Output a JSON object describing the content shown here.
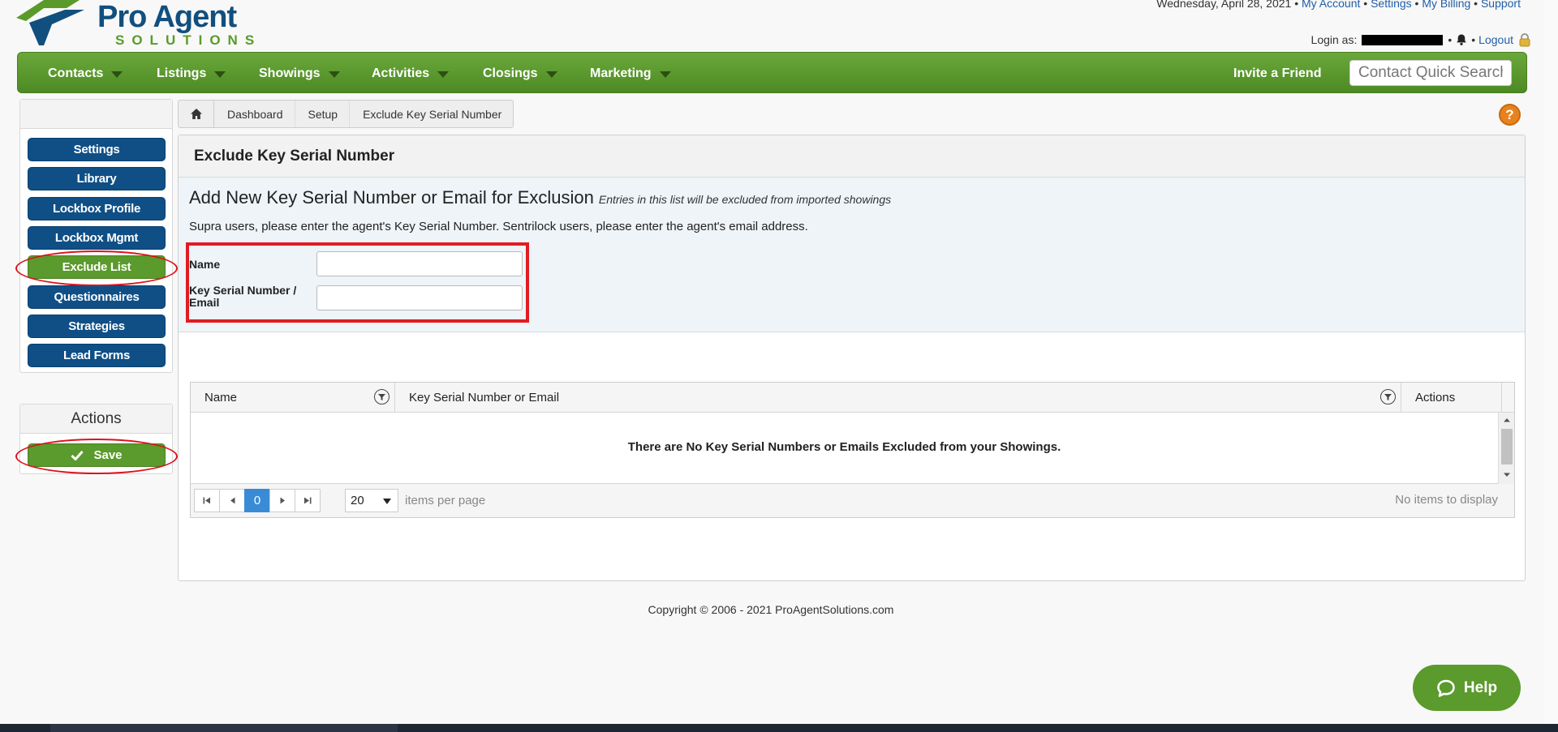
{
  "header": {
    "logo_title": "Pro Agent",
    "logo_subtitle": "SOLUTIONS",
    "date": "Wednesday, April 28, 2021",
    "links": [
      "My Account",
      "Settings",
      "My Billing",
      "Support"
    ],
    "login_label": "Login as:",
    "logout_label": "Logout"
  },
  "nav": {
    "items": [
      "Contacts",
      "Listings",
      "Showings",
      "Activities",
      "Closings",
      "Marketing"
    ],
    "invite_label": "Invite a Friend",
    "search_placeholder": "Contact Quick Search"
  },
  "sidebar": {
    "items": [
      "Settings",
      "Library",
      "Lockbox Profile",
      "Lockbox Mgmt",
      "Exclude List",
      "Questionnaires",
      "Strategies",
      "Lead Forms"
    ],
    "active": "Exclude List",
    "actions_title": "Actions",
    "save_label": "Save"
  },
  "breadcrumb": [
    "Dashboard",
    "Setup",
    "Exclude Key Serial Number"
  ],
  "help_icon_label": "?",
  "page": {
    "title": "Exclude Key Serial Number",
    "form_heading": "Add New Key Serial Number or Email for Exclusion",
    "form_note": "Entries in this list will be excluded from imported showings",
    "form_hint": "Supra users, please enter the agent's Key Serial Number. Sentrilock users, please enter the agent's email address.",
    "name_label": "Name",
    "name_value": "",
    "key_label_line1": "Key Serial Number /",
    "key_label_line2": "Email",
    "key_value": ""
  },
  "grid": {
    "columns": [
      "Name",
      "Key Serial Number or Email",
      "Actions"
    ],
    "rows": [],
    "empty_message": "There are No Key Serial Numbers or Emails Excluded from your Showings.",
    "pager": {
      "current_page": "0",
      "page_size": "20",
      "per_page_label": "items per page",
      "status": "No items to display"
    }
  },
  "footer": {
    "copyright": "Copyright © 2006 - 2021 ProAgentSolutions.com"
  },
  "help_button_label": "Help",
  "colors": {
    "nav_green": "#5b9a2c",
    "sidebar_blue": "#0f4f86",
    "active_green": "#5b9a2c",
    "highlight_red": "#e11b22",
    "pager_active": "#3a8bd6",
    "help_orange": "#e8821f"
  }
}
